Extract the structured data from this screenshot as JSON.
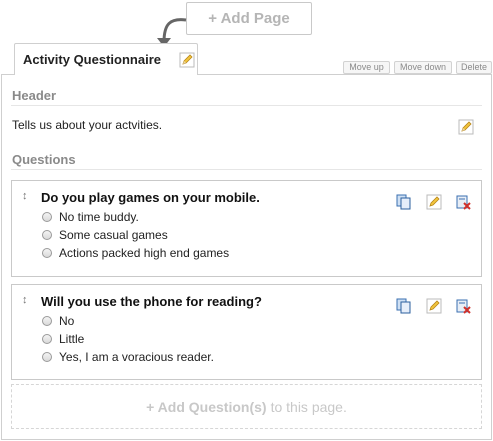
{
  "toolbar": {
    "add_page_label": "+ Add Page"
  },
  "page_tab": {
    "title": "Activity Questionnaire"
  },
  "page_actions": {
    "move_up": "Move up",
    "move_down": "Move down",
    "delete": "Delete"
  },
  "header_section": {
    "label": "Header",
    "text": "Tells us about your actvities."
  },
  "questions_section": {
    "label": "Questions",
    "questions": [
      {
        "title": "Do you play games on your mobile.",
        "options": [
          "No time buddy.",
          "Some casual games",
          "Actions packed high end games"
        ]
      },
      {
        "title": "Will you use the phone for reading?",
        "options": [
          "No",
          "Little",
          "Yes, I am a voracious reader."
        ]
      }
    ]
  },
  "add_question": {
    "bold": "+ Add Question(s)",
    "rest": "to this page."
  },
  "icons": {
    "edit": "pencil-icon",
    "copy": "copy-icon",
    "delete": "delete-icon",
    "drag": "drag-handle-icon"
  }
}
